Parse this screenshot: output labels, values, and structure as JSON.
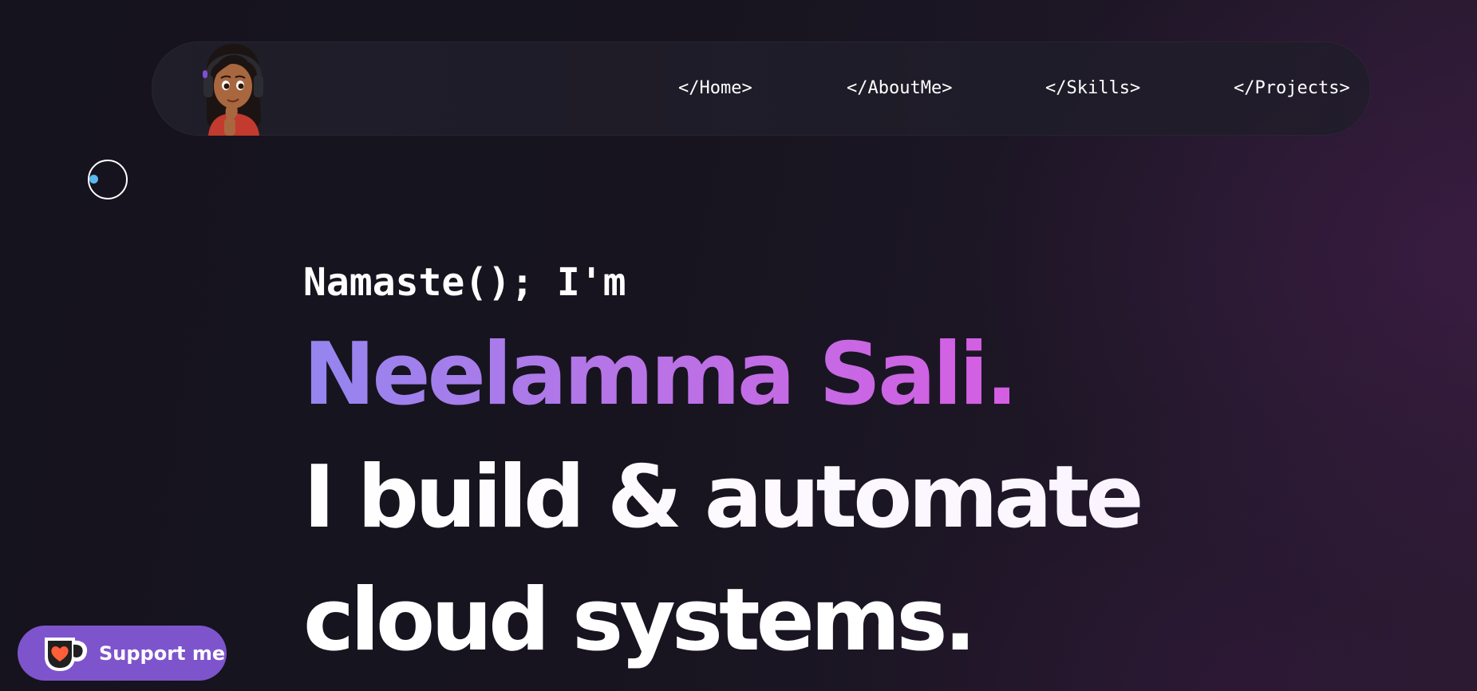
{
  "nav": {
    "links": [
      {
        "label": "</Home>"
      },
      {
        "label": "</AboutMe>"
      },
      {
        "label": "</Skills>"
      },
      {
        "label": "</Projects>"
      }
    ]
  },
  "hero": {
    "greeting": "Namaste(); I'm",
    "name": "Neelamma Sali.",
    "tagline_line1": "I build & automate",
    "tagline_line2": "cloud systems."
  },
  "support": {
    "label": "Support me"
  },
  "colors": {
    "background": "#16141f",
    "name_gradient_start": "#9486ef",
    "name_gradient_end": "#d55ee2",
    "support_button": "#7e54cc",
    "cursor_dot": "#5ab8f0"
  },
  "icons": {
    "avatar": "avatar-illustration",
    "support": "coffee-cup-heart-icon"
  }
}
